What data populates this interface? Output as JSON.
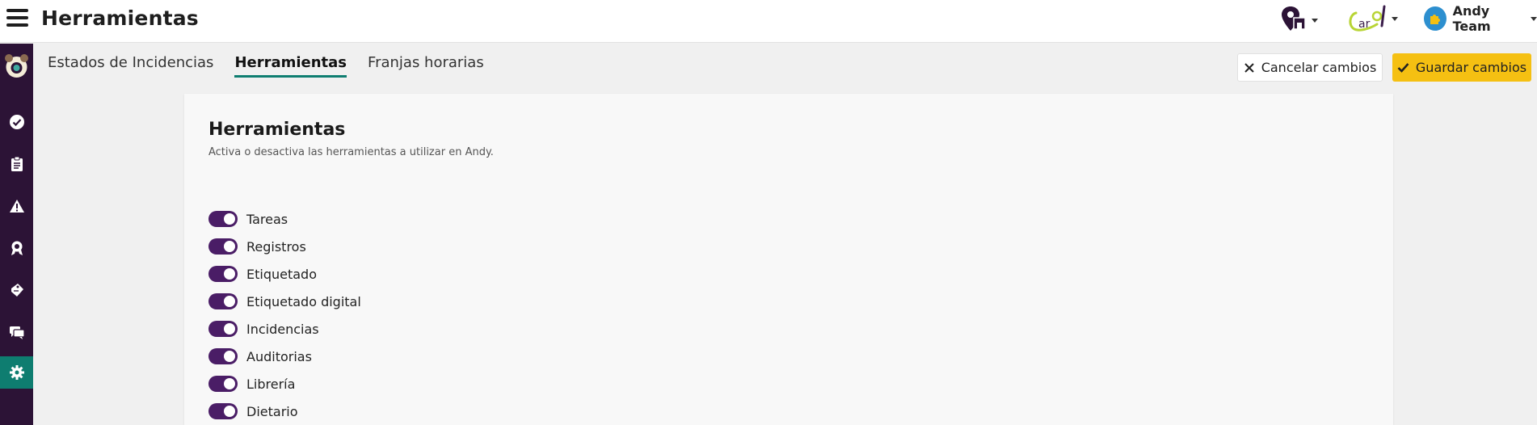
{
  "header": {
    "title": "Herramientas",
    "menu_icon": "hamburger-menu-icon",
    "location_icon": "location-store-icon",
    "brand_logo_text": "Carol",
    "user": {
      "name": "Andy Team",
      "avatar_icon": "puzzle-icon"
    }
  },
  "sidebar": {
    "logo": "andy-logo",
    "items": [
      {
        "icon": "check-circle-icon"
      },
      {
        "icon": "clipboard-icon"
      },
      {
        "icon": "warning-icon"
      },
      {
        "icon": "award-icon"
      },
      {
        "icon": "label-tag-icon"
      },
      {
        "icon": "chat-icon"
      },
      {
        "icon": "settings-gear-icon",
        "active": true
      }
    ]
  },
  "tabs": [
    {
      "label": "Estados de Incidencias",
      "active": false
    },
    {
      "label": "Herramientas",
      "active": true
    },
    {
      "label": "Franjas horarias",
      "active": false
    }
  ],
  "actions": {
    "cancel_label": "Cancelar cambios",
    "save_label": "Guardar cambios"
  },
  "card": {
    "title": "Herramientas",
    "subtitle": "Activa o desactiva las herramientas a utilizar en Andy.",
    "tools": [
      {
        "label": "Tareas",
        "enabled": true
      },
      {
        "label": "Registros",
        "enabled": true
      },
      {
        "label": "Etiquetado",
        "enabled": true
      },
      {
        "label": "Etiquetado digital",
        "enabled": true
      },
      {
        "label": "Incidencias",
        "enabled": true
      },
      {
        "label": "Auditorias",
        "enabled": true
      },
      {
        "label": "Librería",
        "enabled": true
      },
      {
        "label": "Dietario",
        "enabled": true
      }
    ]
  },
  "colors": {
    "sidebar_bg": "#2c1336",
    "active_accent": "#0e7d70",
    "toggle_on": "#4a1d66",
    "save_button": "#f5c012"
  }
}
